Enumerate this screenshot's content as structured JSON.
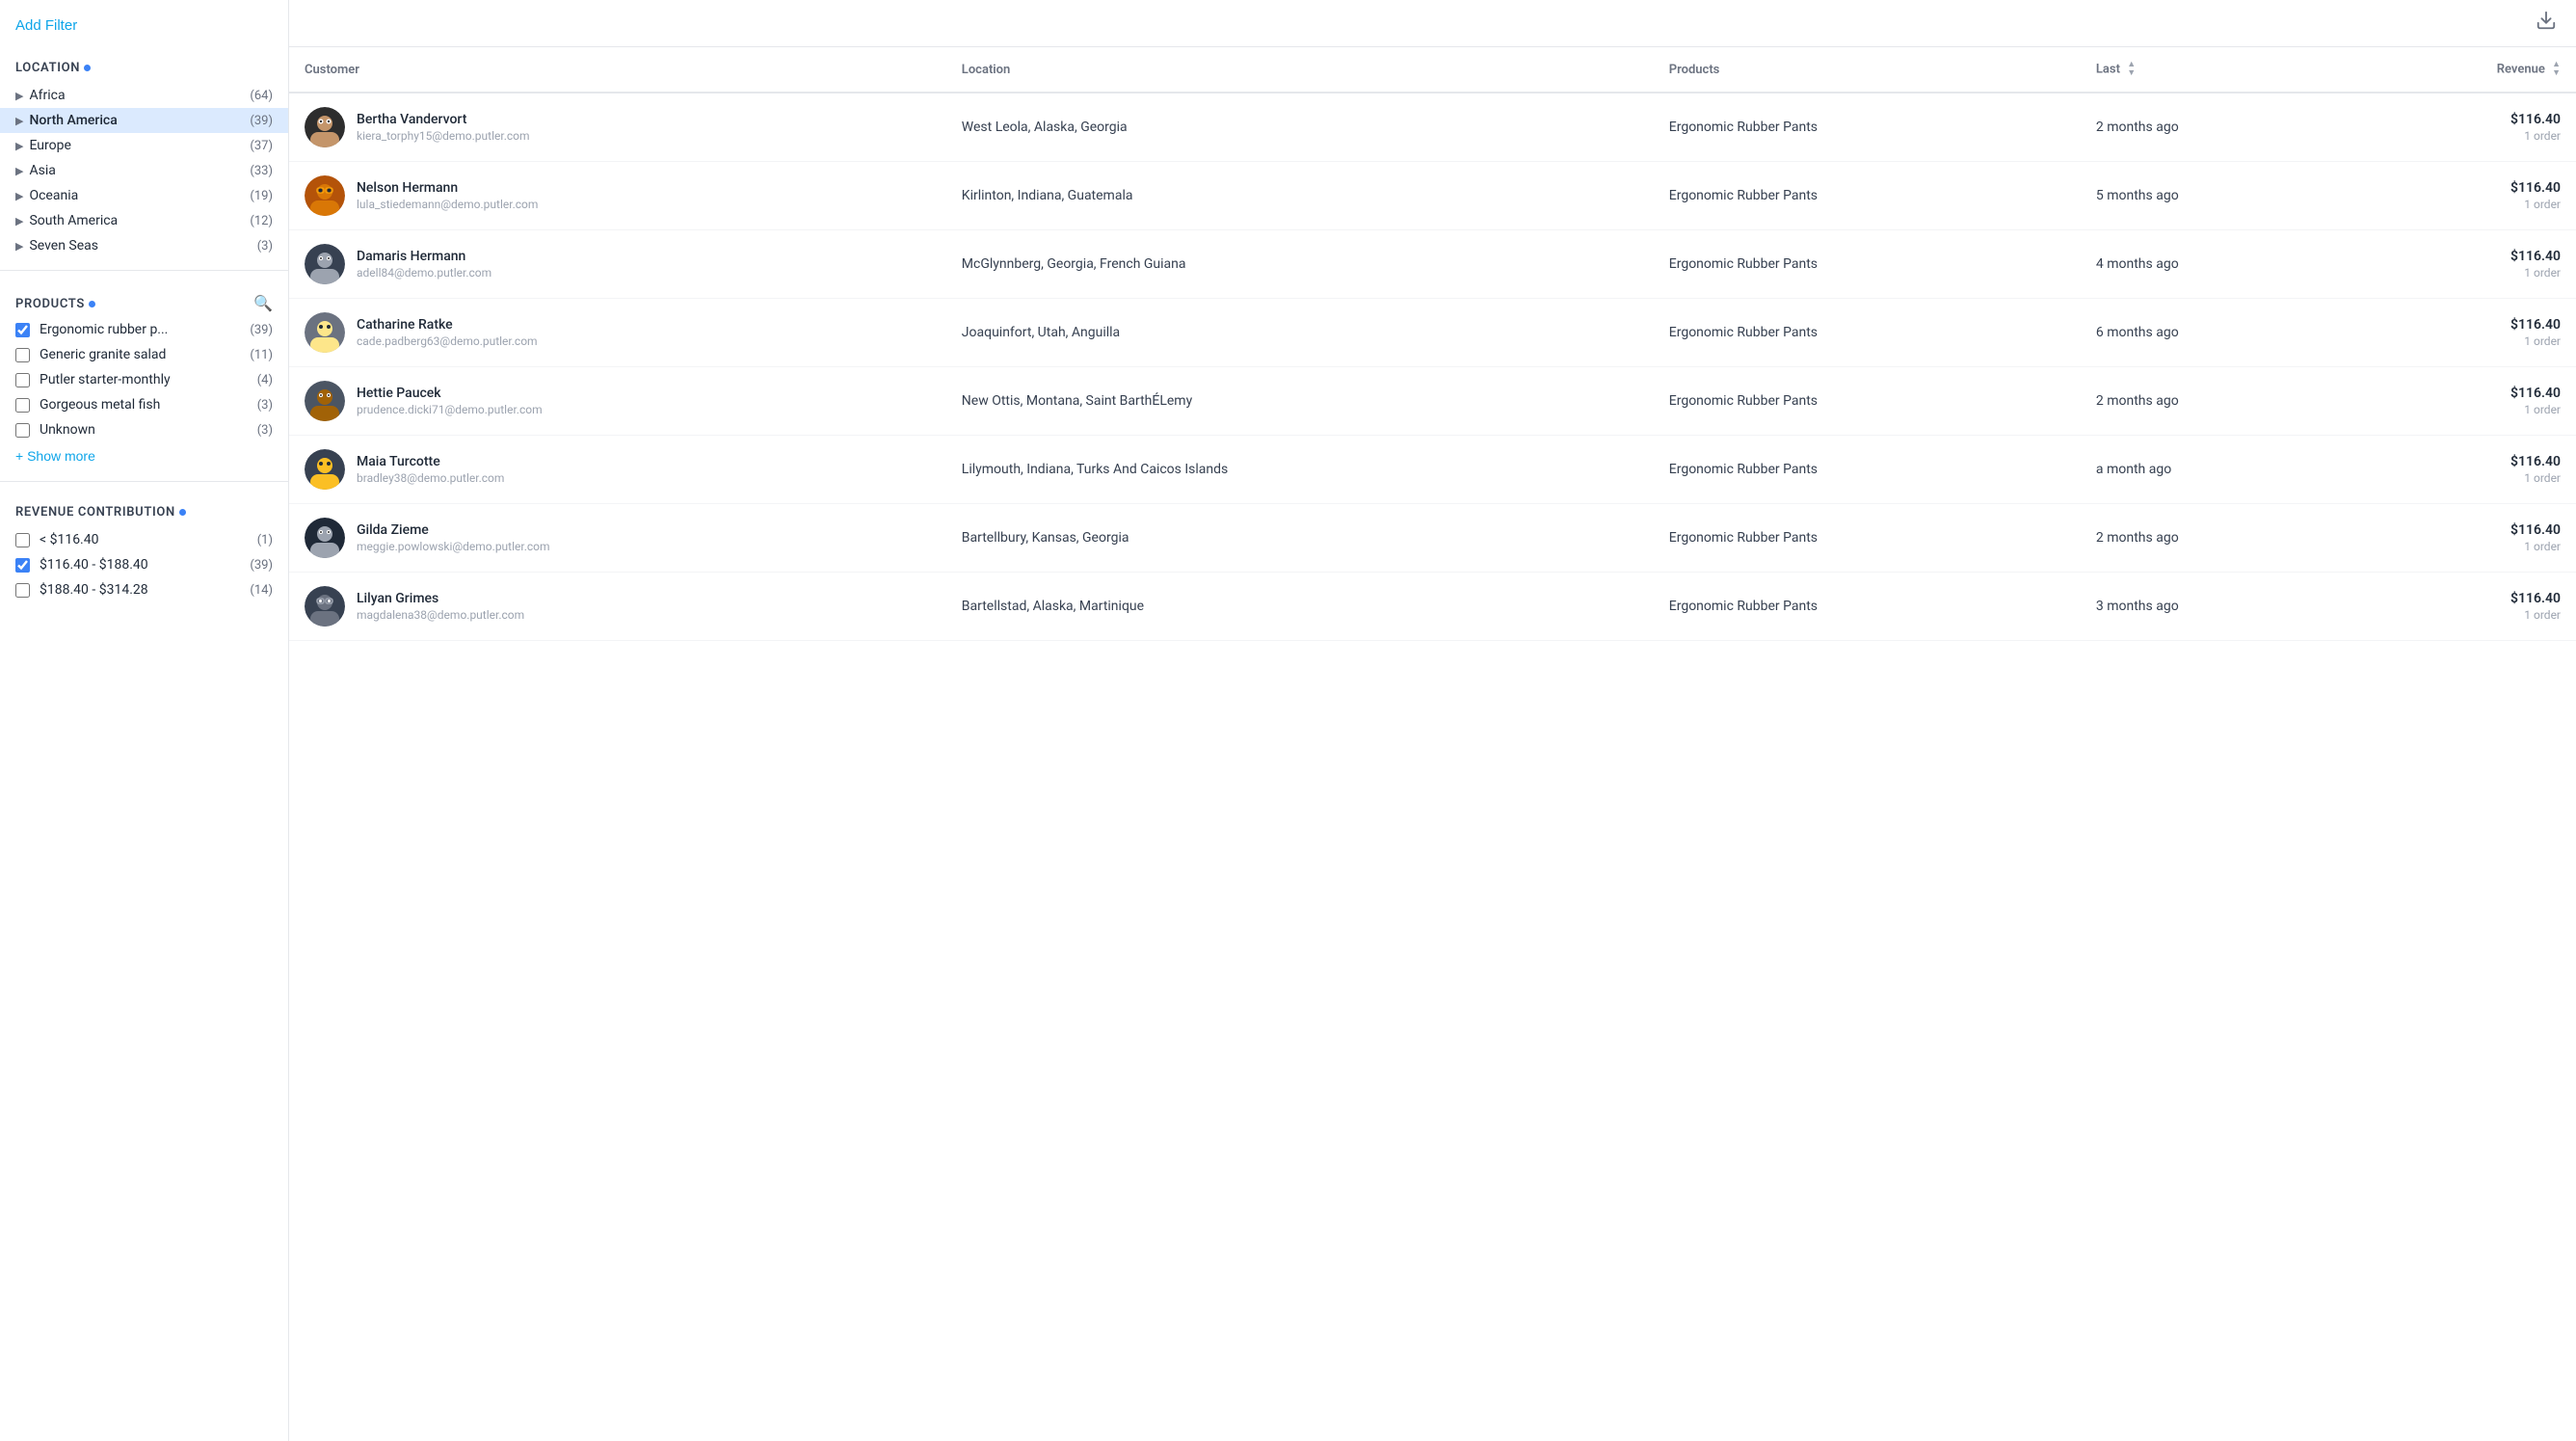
{
  "sidebar": {
    "add_filter_label": "Add Filter",
    "location_section": {
      "title": "Location",
      "items": [
        {
          "label": "Africa",
          "count": 64,
          "active": false
        },
        {
          "label": "North America",
          "count": 39,
          "active": true
        },
        {
          "label": "Europe",
          "count": 37,
          "active": false
        },
        {
          "label": "Asia",
          "count": 33,
          "active": false
        },
        {
          "label": "Oceania",
          "count": 19,
          "active": false
        },
        {
          "label": "South America",
          "count": 12,
          "active": false
        },
        {
          "label": "Seven Seas",
          "count": 3,
          "active": false
        }
      ]
    },
    "products_section": {
      "title": "Products",
      "items": [
        {
          "label": "Ergonomic rubber p...",
          "count": 39,
          "checked": true
        },
        {
          "label": "Generic granite salad",
          "count": 11,
          "checked": false
        },
        {
          "label": "Putler starter-monthly",
          "count": 4,
          "checked": false
        },
        {
          "label": "Gorgeous metal fish",
          "count": 3,
          "checked": false
        },
        {
          "label": "Unknown",
          "count": 3,
          "checked": false
        }
      ],
      "show_more_label": "+ Show more"
    },
    "revenue_section": {
      "title": "Revenue Contribution",
      "items": [
        {
          "label": "< $116.40",
          "count": 1,
          "checked": false
        },
        {
          "label": "$116.40 - $188.40",
          "count": 39,
          "checked": true
        },
        {
          "label": "$188.40 - $314.28",
          "count": 14,
          "checked": false
        }
      ]
    }
  },
  "table": {
    "columns": [
      {
        "key": "customer",
        "label": "Customer",
        "sortable": false
      },
      {
        "key": "location",
        "label": "Location",
        "sortable": false
      },
      {
        "key": "products",
        "label": "Products",
        "sortable": false
      },
      {
        "key": "last",
        "label": "Last",
        "sortable": true
      },
      {
        "key": "revenue",
        "label": "Revenue",
        "sortable": true
      }
    ],
    "rows": [
      {
        "id": 1,
        "name": "Bertha Vandervort",
        "email": "kiera_torphy15@demo.putler.com",
        "avatar_emoji": "🧑",
        "avatar_class": "av-1",
        "location": "West Leola, Alaska, Georgia",
        "product": "Ergonomic Rubber Pants",
        "last": "2 months ago",
        "revenue": "$116.40",
        "orders": "1 order"
      },
      {
        "id": 2,
        "name": "Nelson Hermann",
        "email": "lula_stiedemann@demo.putler.com",
        "avatar_emoji": "🧑",
        "avatar_class": "av-2",
        "location": "Kirlinton, Indiana, Guatemala",
        "product": "Ergonomic Rubber Pants",
        "last": "5 months ago",
        "revenue": "$116.40",
        "orders": "1 order"
      },
      {
        "id": 3,
        "name": "Damaris Hermann",
        "email": "adell84@demo.putler.com",
        "avatar_emoji": "🧑",
        "avatar_class": "av-3",
        "location": "McGlynnberg, Georgia, French Guiana",
        "product": "Ergonomic Rubber Pants",
        "last": "4 months ago",
        "revenue": "$116.40",
        "orders": "1 order"
      },
      {
        "id": 4,
        "name": "Catharine Ratke",
        "email": "cade.padberg63@demo.putler.com",
        "avatar_emoji": "🧑",
        "avatar_class": "av-4",
        "location": "Joaquinfort, Utah, Anguilla",
        "product": "Ergonomic Rubber Pants",
        "last": "6 months ago",
        "revenue": "$116.40",
        "orders": "1 order"
      },
      {
        "id": 5,
        "name": "Hettie Paucek",
        "email": "prudence.dicki71@demo.putler.com",
        "avatar_emoji": "🧑",
        "avatar_class": "av-5",
        "location": "New Ottis, Montana, Saint BarthÉLemy",
        "product": "Ergonomic Rubber Pants",
        "last": "2 months ago",
        "revenue": "$116.40",
        "orders": "1 order"
      },
      {
        "id": 6,
        "name": "Maia Turcotte",
        "email": "bradley38@demo.putler.com",
        "avatar_emoji": "🧑",
        "avatar_class": "av-6",
        "location": "Lilymouth, Indiana, Turks And Caicos Islands",
        "product": "Ergonomic Rubber Pants",
        "last": "a month ago",
        "revenue": "$116.40",
        "orders": "1 order"
      },
      {
        "id": 7,
        "name": "Gilda Zieme",
        "email": "meggie.powlowski@demo.putler.com",
        "avatar_emoji": "🧑",
        "avatar_class": "av-7",
        "location": "Bartellbury, Kansas, Georgia",
        "product": "Ergonomic Rubber Pants",
        "last": "2 months ago",
        "revenue": "$116.40",
        "orders": "1 order"
      },
      {
        "id": 8,
        "name": "Lilyan Grimes",
        "email": "magdalena38@demo.putler.com",
        "avatar_emoji": "🧑",
        "avatar_class": "av-8",
        "location": "Bartellstad, Alaska, Martinique",
        "product": "Ergonomic Rubber Pants",
        "last": "3 months ago",
        "revenue": "$116.40",
        "orders": "1 order"
      }
    ]
  },
  "icons": {
    "download": "⬇",
    "search": "🔍",
    "chevron_right": "▶"
  }
}
